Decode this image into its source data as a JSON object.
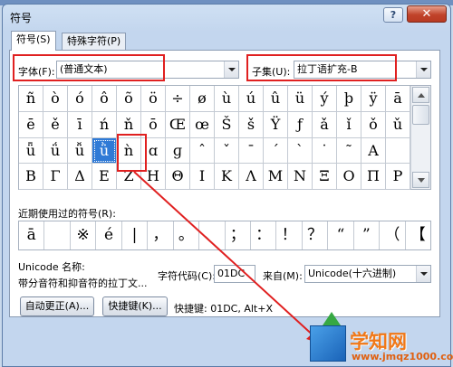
{
  "window": {
    "title": "符号",
    "help": "?",
    "close": "✕"
  },
  "tabs": [
    {
      "label": "符号(S)",
      "active": true
    },
    {
      "label": "特殊字符(P)",
      "active": false
    }
  ],
  "font": {
    "label": "字体(F):",
    "value": "(普通文本)"
  },
  "subset": {
    "label": "子集(U):",
    "value": "拉丁语扩充-B"
  },
  "symbol_grid": {
    "rows": [
      [
        "ñ",
        "ò",
        "ó",
        "ô",
        "õ",
        "ö",
        "÷",
        "ø",
        "ù",
        "ú",
        "û",
        "ü",
        "ý",
        "þ",
        "ÿ",
        "ā"
      ],
      [
        "ē",
        "ě",
        "ī",
        "ń",
        "ň",
        "ō",
        "Œ",
        "œ",
        "Š",
        "š",
        "Ÿ",
        "ƒ",
        "ǎ",
        "ǐ",
        "ǒ",
        "ǔ"
      ],
      [
        "ǖ",
        "ǘ",
        "ǚ",
        "ǜ",
        "ǹ",
        "ɑ",
        "ɡ",
        "ˆ",
        "ˇ",
        "ˉ",
        "ˊ",
        "ˋ",
        "˙",
        "˜",
        "Α",
        ""
      ],
      [
        "Β",
        "Γ",
        "Δ",
        "Ε",
        "Ζ",
        "Η",
        "Θ",
        "Ι",
        "Κ",
        "Λ",
        "Μ",
        "Ν",
        "Ξ",
        "Ο",
        "Π",
        "Ρ"
      ]
    ],
    "selected": "ǜ"
  },
  "recent": {
    "label": "近期使用过的符号(R):",
    "symbols": [
      "ā",
      "",
      "※",
      "é",
      "|",
      "，",
      "。",
      "、",
      "；",
      "：",
      "！",
      "？",
      "“",
      "”",
      "（",
      "【"
    ]
  },
  "unicode": {
    "name_label": "Unicode 名称:",
    "name_value": "带分音符和抑音符的拉丁文...",
    "code_label": "字符代码(C):",
    "code_value": "01DC",
    "from_label": "来自(M):",
    "from_value": "Unicode(十六进制)"
  },
  "buttons": {
    "autocorrect": "自动更正(A)...",
    "shortcut_key": "快捷键(K)..."
  },
  "shortcut_text": "快捷键: 01DC, Alt+X",
  "annotation": {
    "color": "#e02020"
  },
  "watermark": {
    "title": "学知网",
    "subtitle": "www.jmqz1000.com"
  }
}
